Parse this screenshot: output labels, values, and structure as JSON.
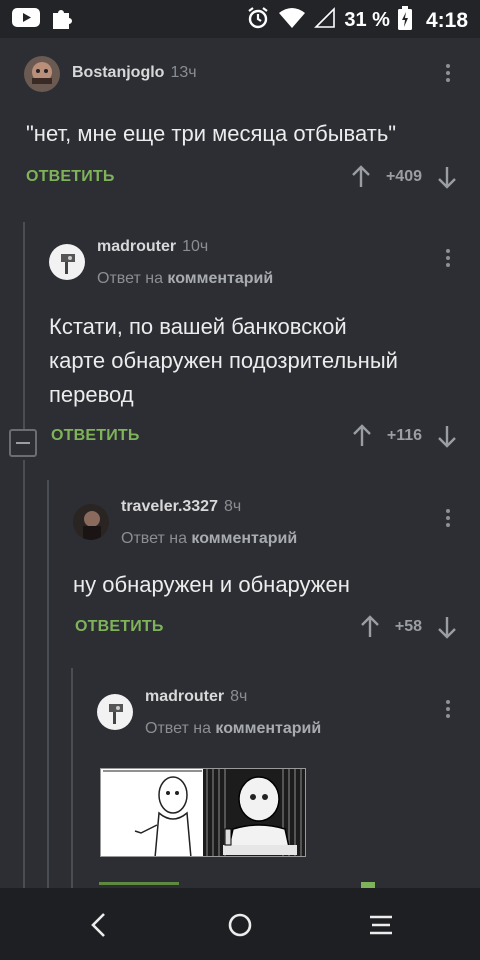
{
  "status_bar": {
    "battery_percent": "31 %",
    "time": "4:18"
  },
  "comments": [
    {
      "username": "Bostanjoglo",
      "time": "13ч",
      "text": "\"нет, мне еще три месяца отбывать\"",
      "reply_label": "ОТВЕТИТЬ",
      "score": "+409"
    },
    {
      "username": "madrouter",
      "time": "10ч",
      "reply_prefix": "Ответ на",
      "reply_target": "комментарий",
      "text_line1": "Кстати, по вашей банковской",
      "text_line2": "карте обнаружен подозрительный",
      "text_line3": "перевод",
      "reply_label": "ОТВЕТИТЬ",
      "score": "+116"
    },
    {
      "username": "traveler.3327",
      "time": "8ч",
      "reply_prefix": "Ответ на",
      "reply_target": "комментарий",
      "text": "ну обнаружен и обнаружен",
      "reply_label": "ОТВЕТИТЬ",
      "score": "+58"
    },
    {
      "username": "madrouter",
      "time": "8ч",
      "reply_prefix": "Ответ на",
      "reply_target": "комментарий"
    }
  ],
  "colors": {
    "background": "#2c2e33",
    "accent_green": "#7fb35a",
    "muted": "#8a8d93"
  },
  "icons": {
    "status_left": [
      "youtube-icon",
      "puzzle-icon"
    ],
    "status_right": [
      "alarm-icon",
      "wifi-icon",
      "signal-icon",
      "battery-icon"
    ],
    "nav": [
      "back-icon",
      "home-icon",
      "menu-icon"
    ]
  }
}
